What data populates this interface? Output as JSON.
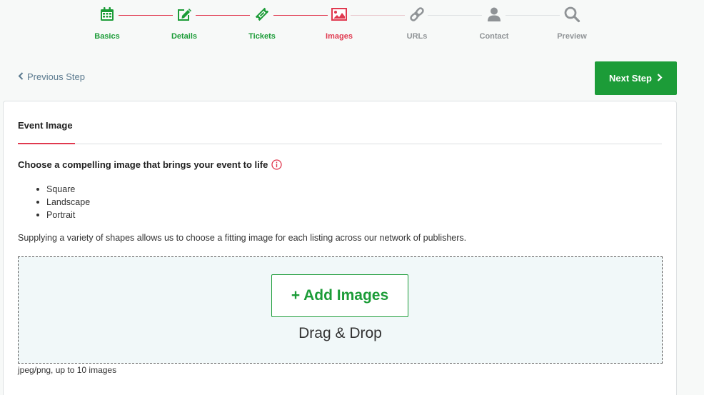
{
  "stepper": {
    "steps": [
      {
        "label": "Basics",
        "icon": "calendar-icon",
        "state": "done"
      },
      {
        "label": "Details",
        "icon": "edit-icon",
        "state": "done"
      },
      {
        "label": "Tickets",
        "icon": "ticket-icon",
        "state": "done"
      },
      {
        "label": "Images",
        "icon": "image-icon",
        "state": "active"
      },
      {
        "label": "URLs",
        "icon": "link-icon",
        "state": "pending"
      },
      {
        "label": "Contact",
        "icon": "user-icon",
        "state": "pending"
      },
      {
        "label": "Preview",
        "icon": "search-icon",
        "state": "pending"
      }
    ]
  },
  "nav": {
    "prev_label": "Previous Step",
    "next_label": "Next Step"
  },
  "card": {
    "tab_label": "Event Image",
    "heading": "Choose a compelling image that brings your event to life",
    "shapes": [
      "Square",
      "Landscape",
      "Portrait"
    ],
    "description": "Supplying a variety of shapes allows us to choose a fitting image for each listing across our network of publishers.",
    "dropzone": {
      "add_label": "+ Add Images",
      "drag_label": "Drag & Drop"
    },
    "hint": "jpeg/png, up to 10 images"
  },
  "colors": {
    "done": "#1c9c38",
    "active": "#e0394f",
    "pending": "#8f9396",
    "primary_button": "#1c9c38"
  }
}
